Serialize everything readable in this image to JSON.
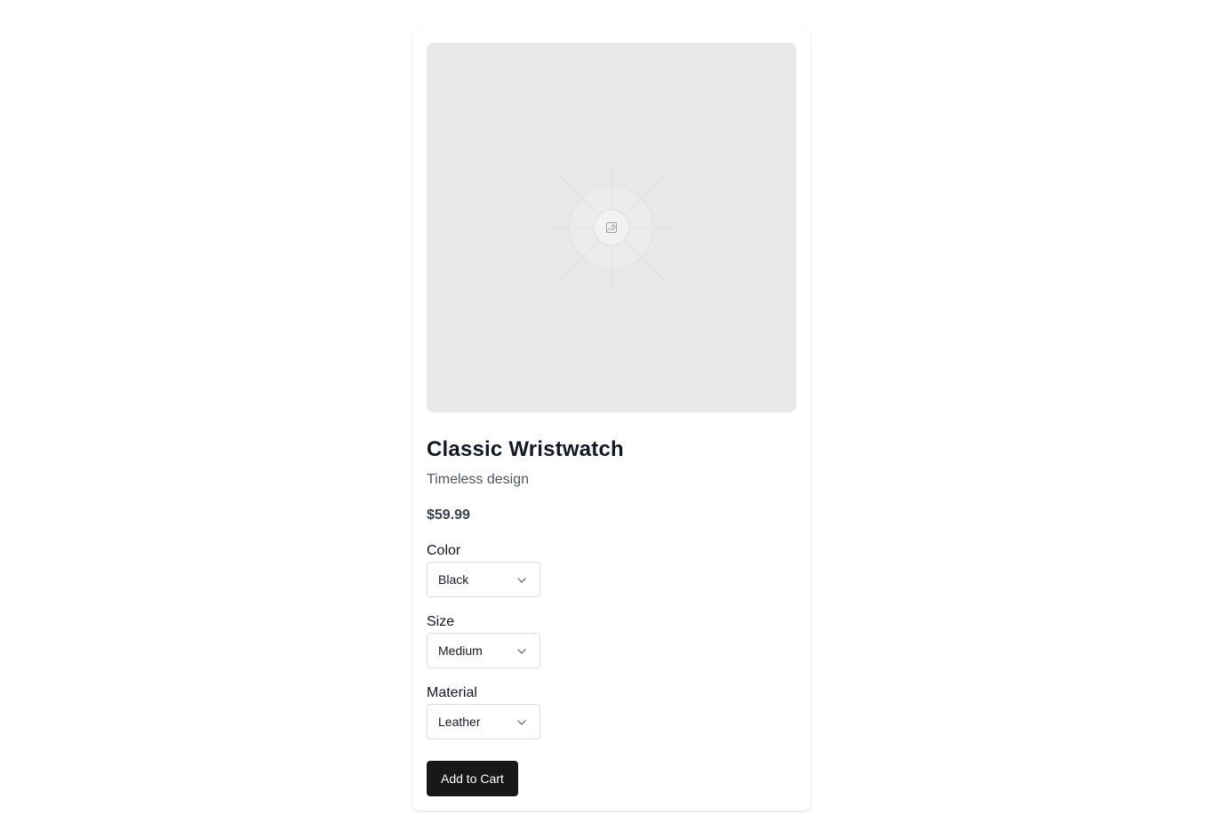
{
  "product": {
    "title": "Classic Wristwatch",
    "subtitle": "Timeless design",
    "price": "$59.99",
    "image_icon": "image-icon"
  },
  "options": [
    {
      "label": "Color",
      "value": "Black"
    },
    {
      "label": "Size",
      "value": "Medium"
    },
    {
      "label": "Material",
      "value": "Leather"
    }
  ],
  "actions": {
    "add_to_cart": "Add to Cart"
  },
  "colors": {
    "button_bg": "#18181b",
    "image_bg": "#e8e8e8"
  }
}
